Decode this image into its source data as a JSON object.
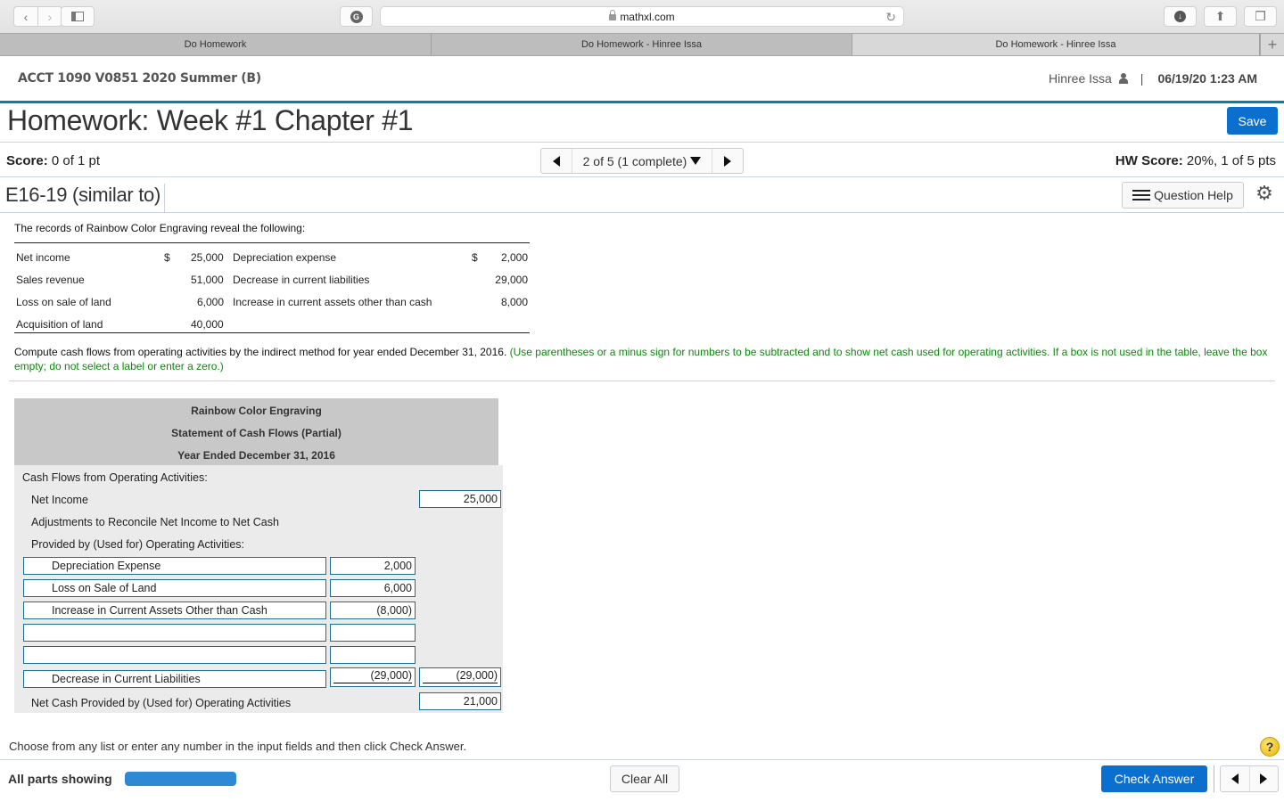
{
  "browser": {
    "url": "mathxl.com",
    "tabs": [
      {
        "label": "Do Homework",
        "active": false
      },
      {
        "label": "Do Homework - Hinree Issa",
        "active": false
      },
      {
        "label": "Do Homework - Hinree Issa",
        "active": true
      }
    ],
    "new_tab_label": "+"
  },
  "header": {
    "course": "ACCT 1090 V0851 2020 Summer (B)",
    "user_name": "Hinree Issa",
    "separator": "|",
    "datetime": "06/19/20 1:23 AM"
  },
  "homework": {
    "title": "Homework: Week #1 Chapter #1",
    "save_label": "Save",
    "score_label": "Score:",
    "score_value": "0 of 1 pt",
    "question_nav": "2 of 5 (1 complete)",
    "hw_score_label": "HW Score:",
    "hw_score_value": "20%, 1 of 5 pts",
    "question_id": "E16-19 (similar to)",
    "question_help_label": "Question Help"
  },
  "problem": {
    "intro": "The records of Rainbow Color Engraving reveal the following:",
    "records": [
      {
        "label1": "Net income",
        "cur1": "$",
        "val1": "25,000",
        "label2": "Depreciation expense",
        "cur2": "$",
        "val2": "2,000"
      },
      {
        "label1": "Sales revenue",
        "cur1": "",
        "val1": "51,000",
        "label2": "Decrease in current liabilities",
        "cur2": "",
        "val2": "29,000"
      },
      {
        "label1": "Loss on sale of land",
        "cur1": "",
        "val1": "6,000",
        "label2": "Increase in current assets other than cash",
        "cur2": "",
        "val2": "8,000"
      },
      {
        "label1": "Acquisition of land",
        "cur1": "",
        "val1": "40,000",
        "label2": "",
        "cur2": "",
        "val2": ""
      }
    ],
    "instruction": "Compute cash flows from operating activities by the indirect method for year ended December 31, 2016.",
    "instruction_note": "(Use parentheses or a minus sign for numbers to be subtracted and to show net cash used for operating activities. If a box is not used in the table, leave the box empty; do not select a label or enter a zero.)"
  },
  "statement": {
    "company": "Rainbow Color Engraving",
    "title": "Statement of Cash Flows (Partial)",
    "period": "Year Ended December 31, 2016",
    "section": "Cash Flows from Operating Activities:",
    "net_income_label": "Net Income",
    "net_income_value": "25,000",
    "adjust_line1": "Adjustments to Reconcile Net Income to Net Cash",
    "adjust_line2": "Provided by (Used for) Operating Activities:",
    "adjustments": [
      {
        "label": "Depreciation Expense",
        "value": "2,000"
      },
      {
        "label": "Loss on Sale of Land",
        "value": "6,000"
      },
      {
        "label": "Increase in Current Assets Other than Cash",
        "value": "(8,000)"
      },
      {
        "label": "",
        "value": ""
      },
      {
        "label": "",
        "value": ""
      },
      {
        "label": "Decrease in Current Liabilities",
        "value": "(29,000)"
      }
    ],
    "total_adjustments": "(29,000)",
    "net_cash_label": "Net Cash Provided by (Used for) Operating Activities",
    "net_cash_value": "21,000"
  },
  "footer": {
    "choose_text": "Choose from any list or enter any number in the input fields and then click Check Answer.",
    "all_parts_label": "All parts showing",
    "progress_fraction": 1.0,
    "clear_all_label": "Clear All",
    "check_answer_label": "Check Answer",
    "help_icon_label": "?"
  },
  "colors": {
    "accent_blue": "#0b6fcf",
    "teal_rule": "#0a7ea4",
    "note_green": "#0a8a0a",
    "input_border": "#1e6f8e"
  }
}
